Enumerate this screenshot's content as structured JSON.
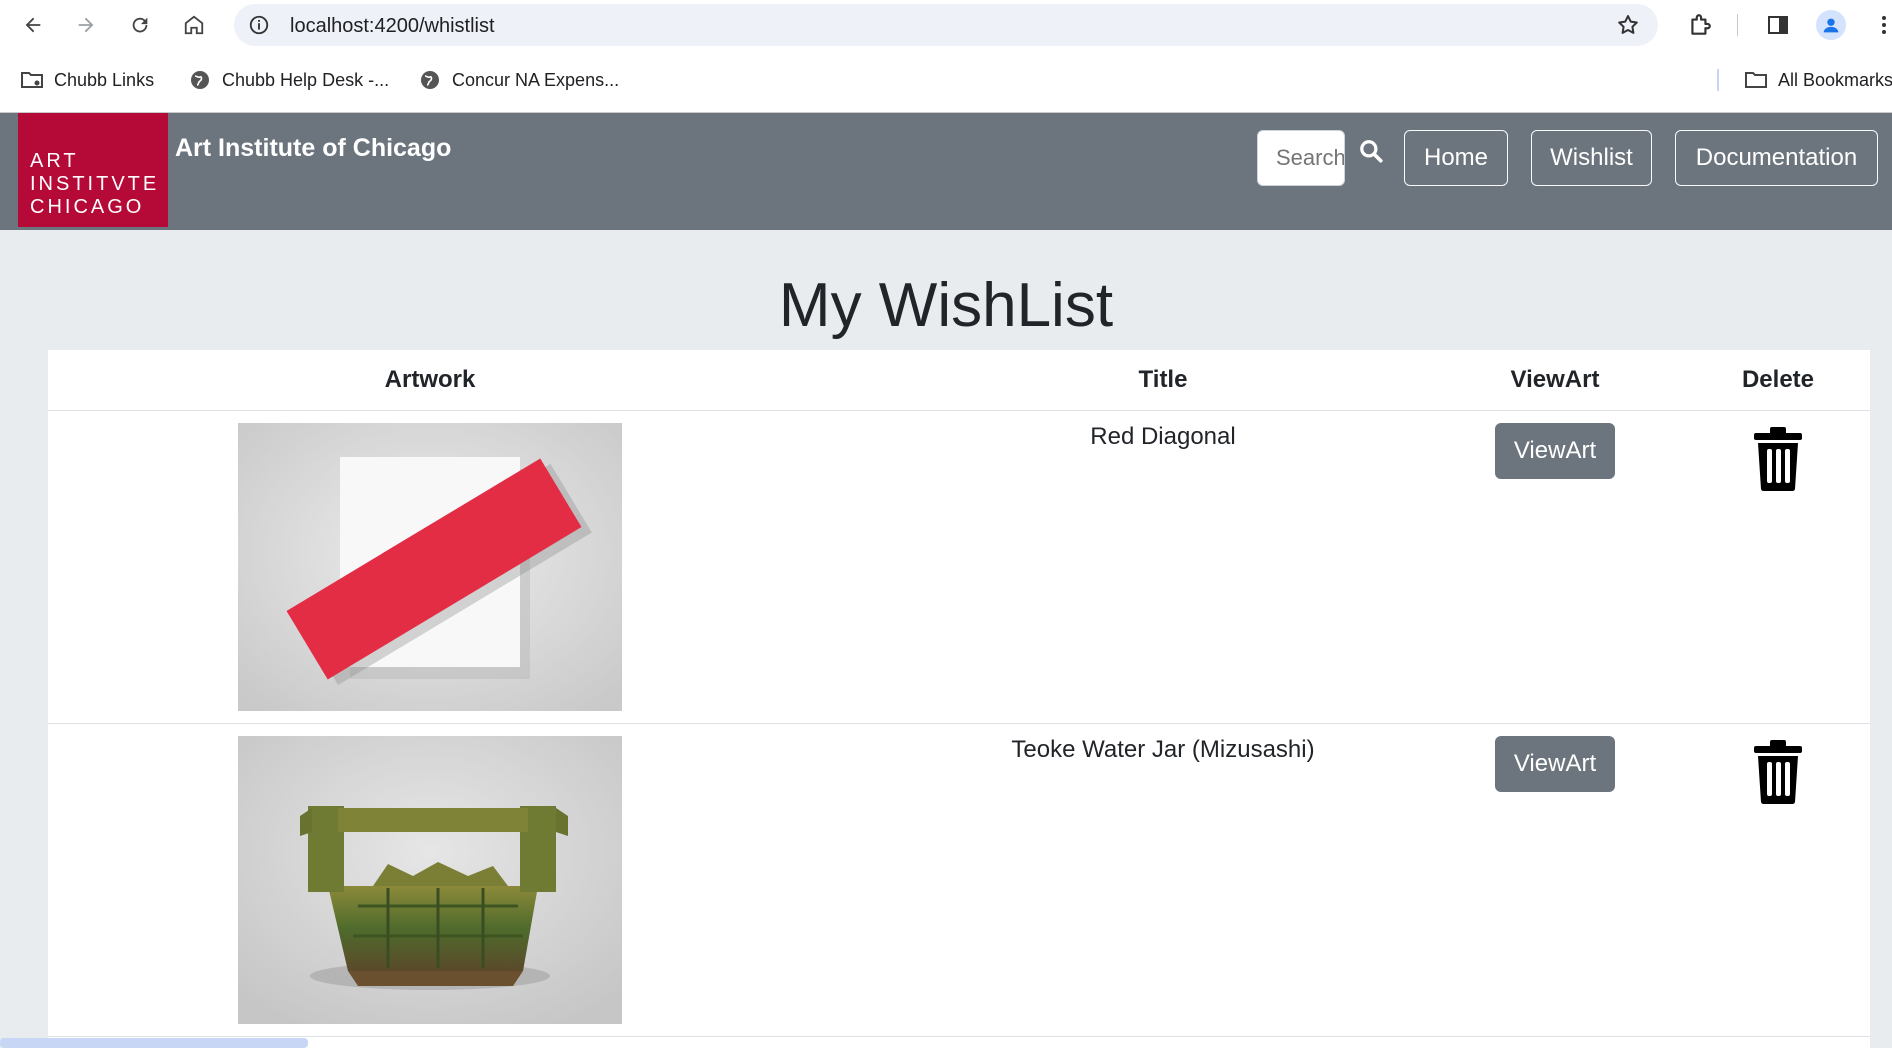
{
  "browser": {
    "url": "localhost:4200/whistlist",
    "bookmarks": [
      {
        "label": "Chubb Links",
        "icon": "folder-icon"
      },
      {
        "label": "Chubb Help Desk -...",
        "icon": "globe-icon"
      },
      {
        "label": "Concur NA Expens...",
        "icon": "globe-icon"
      }
    ],
    "all_bookmarks": "All Bookmarks"
  },
  "app": {
    "logo_lines": [
      "ART",
      "INSTITVTE",
      "CHICAGO"
    ],
    "brand": "Art Institute of Chicago",
    "search_placeholder": "Search",
    "nav": {
      "home": "Home",
      "wishlist": "Wishlist",
      "documentation": "Documentation"
    },
    "logo_color": "#b50938",
    "navbar_color": "#6c757d"
  },
  "page": {
    "title": "My WishList",
    "columns": {
      "artwork": "Artwork",
      "title": "Title",
      "viewart": "ViewArt",
      "delete": "Delete"
    },
    "rows": [
      {
        "title": "Red Diagonal",
        "view_label": "ViewArt"
      },
      {
        "title": "Teoke Water Jar (Mizusashi)",
        "view_label": "ViewArt"
      }
    ]
  }
}
